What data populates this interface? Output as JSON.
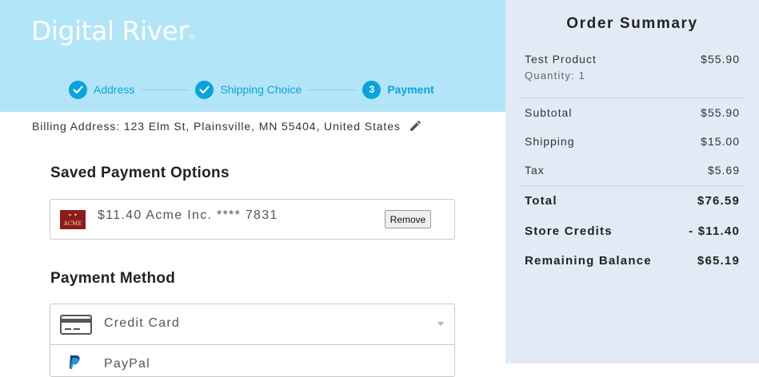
{
  "header": {
    "logo_text": "Digital River",
    "logo_mark": "®",
    "steps": [
      {
        "label": "Address",
        "state": "complete",
        "icon": "check-icon"
      },
      {
        "label": "Shipping Choice",
        "state": "complete",
        "icon": "check-icon"
      },
      {
        "label": "Payment",
        "state": "active",
        "number": "3"
      }
    ],
    "accent_color": "#0aa3de"
  },
  "billing": {
    "text": "Billing Address: 123 Elm St, Plainsville, MN 55404, United States",
    "edit_icon": "pencil-icon"
  },
  "saved_payments": {
    "title": "Saved Payment Options",
    "items": [
      {
        "logo_text": "ACME",
        "description": "$11.40 Acme Inc. **** 7831",
        "remove_label": "Remove"
      }
    ]
  },
  "payment_method": {
    "title": "Payment Method",
    "options": [
      {
        "label": "Credit Card",
        "icon": "credit-card-icon"
      },
      {
        "label": "PayPal",
        "icon": "paypal-icon"
      }
    ]
  },
  "summary": {
    "title": "Order Summary",
    "product": {
      "name": "Test Product",
      "quantity": "Quantity: 1",
      "price": "$55.90"
    },
    "subtotal": {
      "label": "Subtotal",
      "value": "$55.90"
    },
    "shipping": {
      "label": "Shipping",
      "value": "$15.00"
    },
    "tax": {
      "label": "Tax",
      "value": "$5.69"
    },
    "total": {
      "label": "Total",
      "value": "$76.59"
    },
    "store_credits": {
      "label": "Store Credits",
      "value": "- $11.40"
    },
    "remaining": {
      "label": "Remaining Balance",
      "value": "$65.19"
    }
  }
}
